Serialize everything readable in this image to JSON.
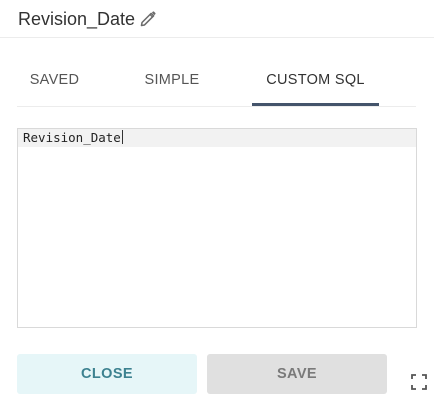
{
  "header": {
    "title": "Revision_Date",
    "edit_icon": "pencil-icon"
  },
  "tabs": [
    {
      "label": "SAVED",
      "active": false
    },
    {
      "label": "SIMPLE",
      "active": false
    },
    {
      "label": "CUSTOM SQL",
      "active": true
    }
  ],
  "editor": {
    "value": "Revision_Date"
  },
  "footer": {
    "close_label": "CLOSE",
    "save_label": "SAVE",
    "expand_icon": "expand-icon"
  },
  "colors": {
    "active_tab_underline": "#44546b",
    "close_bg": "#e6f6f8",
    "close_text": "#3d8290",
    "save_bg": "#e0e0e0",
    "save_text": "#7a7a7a"
  }
}
